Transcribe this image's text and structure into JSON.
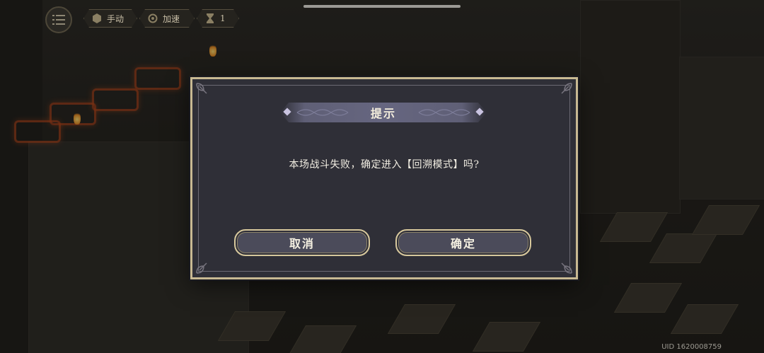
{
  "hud": {
    "menu_icon": "list-menu-icon",
    "manual_label": "手动",
    "speed_label": "加速",
    "turn_count": "1"
  },
  "dialog": {
    "title": "提示",
    "message": "本场战斗失败，确定进入【回溯模式】吗?",
    "cancel_label": "取消",
    "confirm_label": "确定"
  },
  "footer": {
    "uid": "UID 1620008759"
  },
  "colors": {
    "dialog_bg": "#2f2f37",
    "dialog_border": "#c8b992",
    "title_band": "#666680",
    "button_bg": "#4b4b5a",
    "button_border": "#d7c89c",
    "text": "#f1ede2"
  }
}
